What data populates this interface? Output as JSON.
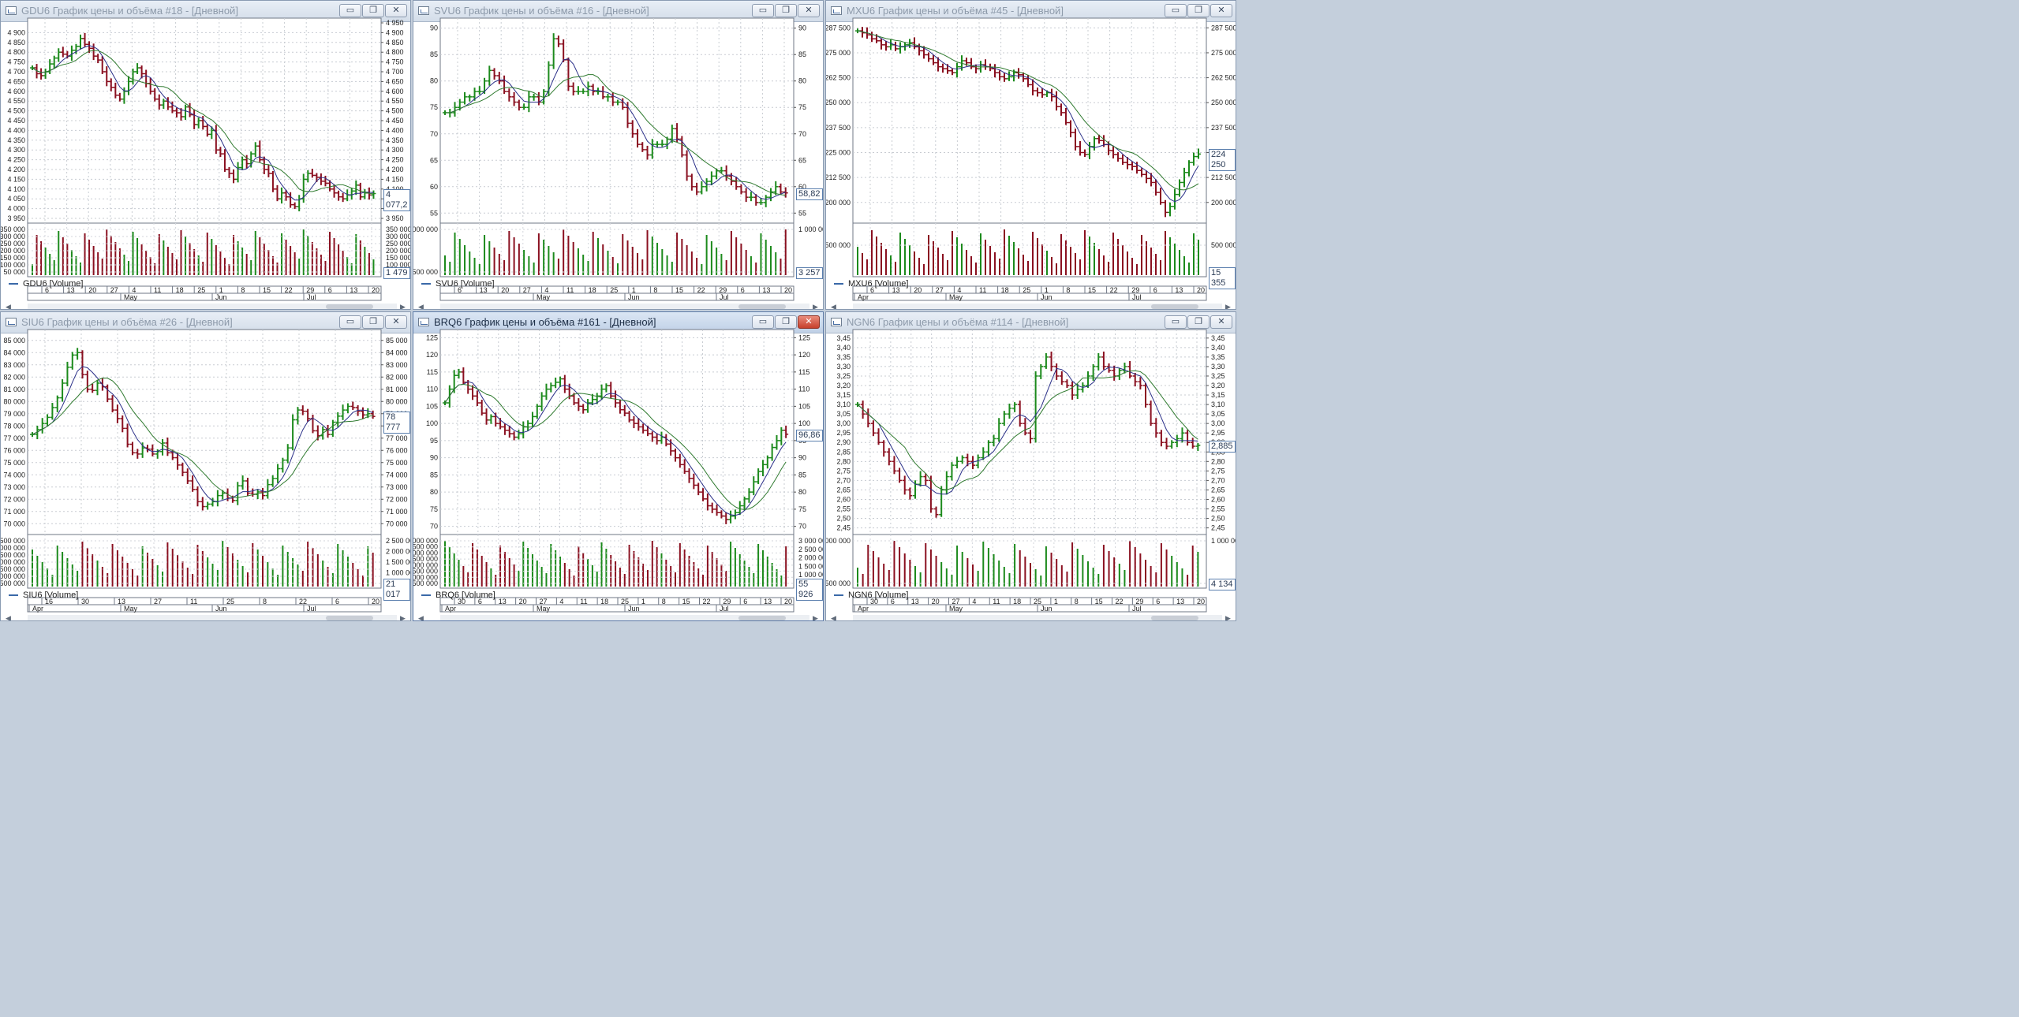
{
  "windows": [
    {
      "id": "gdu6",
      "title": "GDU6 График цены и объёма #18 - [Дневной]",
      "volume_label": "GDU6 [Volume]",
      "price_last": "4 077,2",
      "volume_last": "1 479",
      "price_ticks": [
        "4 900",
        "4 850",
        "4 800",
        "4 750",
        "4 700",
        "4 650",
        "4 600",
        "4 550",
        "4 500",
        "4 450",
        "4 400",
        "4 350",
        "4 300",
        "4 250",
        "4 200",
        "4 150",
        "4 100",
        "4 050",
        "4 000",
        "3 950"
      ],
      "price_ticks_right": [
        "4 950",
        "4 900",
        "4 850",
        "4 800",
        "4 750",
        "4 700",
        "4 650",
        "4 600",
        "4 550",
        "4 500",
        "4 450",
        "4 400",
        "4 350",
        "4 300",
        "4 250",
        "4 200",
        "4 150",
        "4 100",
        "4 050",
        "4 000",
        "3 950"
      ],
      "volume_ticks": [
        "350 000",
        "300 000",
        "250 000",
        "200 000",
        "150 000",
        "100 000",
        "50 000"
      ],
      "volume_ticks_right": [
        "350 000",
        "300 000",
        "250 000",
        "200 000",
        "150 000",
        "100 000",
        "50 000"
      ],
      "date_days": [
        "6",
        "13",
        "20",
        "27",
        "4",
        "11",
        "18",
        "25",
        "1",
        "8",
        "15",
        "22",
        "29",
        "6",
        "13",
        "20"
      ],
      "date_months": [
        "May",
        "Jun",
        "Jul"
      ]
    },
    {
      "id": "svu6",
      "title": "SVU6 График цены и объёма #16 - [Дневной]",
      "volume_label": "SVU6 [Volume]",
      "price_last": "58,82",
      "volume_last": "3 257",
      "price_ticks": [
        "90",
        "85",
        "80",
        "75",
        "70",
        "65",
        "60",
        "55"
      ],
      "price_ticks_right": [
        "90",
        "85",
        "80",
        "75",
        "70",
        "65",
        "60",
        "55"
      ],
      "volume_ticks": [
        "000 000",
        "500 000"
      ],
      "volume_ticks_right": [
        "1 000 000",
        "500 000"
      ],
      "date_days": [
        "6",
        "13",
        "20",
        "27",
        "4",
        "11",
        "18",
        "25",
        "1",
        "8",
        "15",
        "22",
        "29",
        "6",
        "13",
        "20"
      ],
      "date_months": [
        "May",
        "Jun",
        "Jul"
      ]
    },
    {
      "id": "mxu6",
      "title": "MXU6 График цены и объёма #45 - [Дневной]",
      "volume_label": "MXU6 [Volume]",
      "price_last": "224 250",
      "volume_last": "15 355",
      "price_ticks": [
        "287 500",
        "275 000",
        "262 500",
        "250 000",
        "237 500",
        "225 000",
        "212 500",
        "200 000"
      ],
      "price_ticks_right": [
        "287 500",
        "275 000",
        "262 500",
        "250 000",
        "237 500",
        "225 000",
        "212 500",
        "200 000"
      ],
      "volume_ticks": [
        "500 000"
      ],
      "volume_ticks_right": [
        "500 000"
      ],
      "date_days": [
        "6",
        "13",
        "20",
        "27",
        "4",
        "11",
        "18",
        "25",
        "1",
        "8",
        "15",
        "22",
        "29",
        "6",
        "13",
        "20"
      ],
      "date_months": [
        "Apr",
        "May",
        "Jun",
        "Jul"
      ]
    },
    {
      "id": "siu6",
      "title": "SIU6 График цены и объёма #26 - [Дневной]",
      "volume_label": "SIU6 [Volume]",
      "price_last": "78 777",
      "volume_last": "21 017",
      "price_ticks": [
        "85 000",
        "84 000",
        "83 000",
        "82 000",
        "81 000",
        "80 000",
        "79 000",
        "78 000",
        "77 000",
        "76 000",
        "75 000",
        "74 000",
        "73 000",
        "72 000",
        "71 000",
        "70 000"
      ],
      "price_ticks_right": [
        "85 000",
        "84 000",
        "83 000",
        "82 000",
        "81 000",
        "80 000",
        "79 000",
        "78 000",
        "77 000",
        "76 000",
        "75 000",
        "74 000",
        "73 000",
        "72 000",
        "71 000",
        "70 000"
      ],
      "volume_ticks": [
        "500 000",
        "000 000",
        "500 000",
        "000 000",
        "500 000",
        "000 000",
        "500 000"
      ],
      "volume_ticks_right": [
        "2 500 000",
        "2 000 000",
        "1 500 000",
        "1 000 000",
        "500 000"
      ],
      "date_days": [
        "16",
        "30",
        "13",
        "27",
        "11",
        "25",
        "8",
        "22",
        "6",
        "20"
      ],
      "date_months": [
        "Apr",
        "May",
        "Jun",
        "Jul"
      ]
    },
    {
      "id": "brq6",
      "title": "BRQ6 График цены и объёма #161 - [Дневной]",
      "volume_label": "BRQ6 [Volume]",
      "price_last": "96,86",
      "volume_last": "55 926",
      "price_ticks": [
        "125",
        "120",
        "115",
        "110",
        "105",
        "100",
        "95",
        "90",
        "85",
        "80",
        "75",
        "70"
      ],
      "price_ticks_right": [
        "125",
        "120",
        "115",
        "110",
        "105",
        "100",
        "95",
        "90",
        "85",
        "80",
        "75",
        "70"
      ],
      "volume_ticks": [
        "000 000",
        "500 000",
        "000 000",
        "500 000",
        "000 000",
        "500 000",
        "000 000",
        "500 000"
      ],
      "volume_ticks_right": [
        "3 000 000",
        "2 500 000",
        "2 000 000",
        "1 500 000",
        "1 000 000",
        "500 000"
      ],
      "date_days": [
        "30",
        "6",
        "13",
        "20",
        "27",
        "4",
        "11",
        "18",
        "25",
        "1",
        "8",
        "15",
        "22",
        "29",
        "6",
        "13",
        "20"
      ],
      "date_months": [
        "Apr",
        "May",
        "Jun",
        "Jul"
      ]
    },
    {
      "id": "ngn6",
      "title": "NGN6 График цены и объёма #114 - [Дневной]",
      "volume_label": "NGN6 [Volume]",
      "price_last": "2,885",
      "volume_last": "4 134",
      "price_ticks": [
        "3,45",
        "3,40",
        "3,35",
        "3,30",
        "3,25",
        "3,20",
        "3,15",
        "3,10",
        "3,05",
        "3,00",
        "2,95",
        "2,90",
        "2,85",
        "2,80",
        "2,75",
        "2,70",
        "2,65",
        "2,60",
        "2,55",
        "2,50",
        "2,45"
      ],
      "price_ticks_right": [
        "3,45",
        "3,40",
        "3,35",
        "3,30",
        "3,25",
        "3,20",
        "3,15",
        "3,10",
        "3,05",
        "3,00",
        "2,95",
        "2,90",
        "2,85",
        "2,80",
        "2,75",
        "2,70",
        "2,65",
        "2,60",
        "2,55",
        "2,50",
        "2,45"
      ],
      "volume_ticks": [
        "000 000",
        "500 000"
      ],
      "volume_ticks_right": [
        "1 000 000",
        "500 000"
      ],
      "date_days": [
        "30",
        "6",
        "13",
        "20",
        "27",
        "4",
        "11",
        "18",
        "25",
        "1",
        "8",
        "15",
        "22",
        "29",
        "6",
        "13",
        "20"
      ],
      "date_months": [
        "Apr",
        "May",
        "Jun",
        "Jul"
      ]
    }
  ],
  "window_buttons": {
    "minimize": "▭",
    "restore": "❐",
    "close": "✕"
  },
  "chart_data": [
    {
      "type": "ohlc",
      "window": "gdu6",
      "ylim": [
        3950,
        4950
      ],
      "closes": [
        4720,
        4690,
        4680,
        4700,
        4740,
        4770,
        4800,
        4790,
        4780,
        4810,
        4830,
        4870,
        4840,
        4820,
        4780,
        4760,
        4700,
        4650,
        4620,
        4580,
        4560,
        4600,
        4650,
        4700,
        4720,
        4690,
        4640,
        4600,
        4560,
        4530,
        4550,
        4520,
        4500,
        4490,
        4470,
        4520,
        4480,
        4430,
        4450,
        4420,
        4380,
        4400,
        4300,
        4280,
        4200,
        4180,
        4150,
        4210,
        4250,
        4230,
        4280,
        4320,
        4250,
        4200,
        4180,
        4100,
        4050,
        4080,
        4060,
        4020,
        4010,
        4050,
        4150,
        4180,
        4170,
        4160,
        4140,
        4130,
        4100,
        4080,
        4060,
        4050,
        4070,
        4090,
        4120,
        4060,
        4080,
        4070,
        4077
      ]
    },
    {
      "type": "ohlc",
      "window": "svu6",
      "ylim": [
        54,
        91
      ],
      "closes": [
        74,
        74,
        75,
        76,
        77,
        77,
        78,
        78,
        80,
        82,
        81,
        80,
        78,
        77,
        76,
        75,
        75,
        77,
        77,
        76,
        78,
        83,
        88,
        87,
        84,
        79,
        78,
        78,
        78,
        79,
        78,
        78,
        77,
        77,
        76,
        76,
        75,
        72,
        70,
        68,
        67,
        66,
        68,
        68,
        68,
        69,
        71,
        69,
        66,
        62,
        60,
        59,
        60,
        61,
        62,
        63,
        63,
        62,
        61,
        60,
        59,
        58,
        58,
        57,
        57,
        58,
        59,
        60,
        59,
        58.82
      ]
    },
    {
      "type": "ohlc",
      "window": "mxu6",
      "ylim": [
        192000,
        290000
      ],
      "closes": [
        286000,
        285000,
        284000,
        282000,
        281000,
        279000,
        278000,
        279000,
        277000,
        278000,
        279000,
        280000,
        278000,
        276000,
        274000,
        272000,
        270000,
        268000,
        267000,
        266000,
        265000,
        268000,
        271000,
        270000,
        268000,
        267000,
        269000,
        268000,
        267000,
        265000,
        263000,
        262000,
        263000,
        265000,
        264000,
        262000,
        259000,
        256000,
        255000,
        254000,
        255000,
        253000,
        248000,
        245000,
        240000,
        235000,
        228000,
        225000,
        224000,
        228000,
        232000,
        231000,
        229000,
        226000,
        224000,
        222000,
        220000,
        219000,
        218000,
        216000,
        214000,
        212000,
        210000,
        205000,
        200000,
        195000,
        198000,
        204000,
        210000,
        215000,
        220000,
        223000,
        224250
      ]
    },
    {
      "type": "ohlc",
      "window": "siu6",
      "ylim": [
        69500,
        85500
      ],
      "closes": [
        77300,
        77700,
        78200,
        78700,
        79500,
        80300,
        81500,
        82800,
        83800,
        84000,
        82200,
        81000,
        80900,
        81500,
        81200,
        80200,
        79300,
        78600,
        77800,
        76500,
        75800,
        75700,
        76200,
        76100,
        75700,
        75900,
        76600,
        75800,
        75400,
        74800,
        74200,
        73500,
        72800,
        71800,
        71400,
        71600,
        71800,
        72300,
        72500,
        72100,
        71900,
        73100,
        73500,
        72500,
        72400,
        72600,
        72300,
        73200,
        73700,
        74500,
        75200,
        76200,
        78500,
        79300,
        79200,
        78600,
        77600,
        77200,
        77700,
        77300,
        78300,
        78800,
        79300,
        79600,
        79500,
        79200,
        78900,
        79000,
        78777
      ]
    },
    {
      "type": "ohlc",
      "window": "brq6",
      "ylim": [
        69,
        126
      ],
      "closes": [
        106,
        110,
        114,
        115,
        112,
        110,
        108,
        106,
        103,
        101,
        102,
        100,
        99,
        98,
        97,
        96,
        97,
        99,
        100,
        102,
        105,
        108,
        110,
        111,
        112,
        113,
        110,
        108,
        106,
        105,
        104,
        106,
        107,
        108,
        110,
        111,
        108,
        106,
        104,
        103,
        101,
        100,
        99,
        98,
        97,
        96,
        95,
        96,
        94,
        92,
        90,
        88,
        86,
        84,
        82,
        80,
        78,
        76,
        75,
        74,
        73,
        72,
        73,
        74,
        76,
        78,
        80,
        83,
        86,
        88,
        90,
        93,
        95,
        98,
        96.86
      ]
    },
    {
      "type": "ohlc",
      "window": "ngn6",
      "ylim": [
        2.44,
        3.47
      ],
      "closes": [
        3.1,
        3.05,
        3.0,
        2.95,
        2.9,
        2.85,
        2.8,
        2.75,
        2.7,
        2.65,
        2.62,
        2.68,
        2.72,
        2.7,
        2.55,
        2.52,
        2.65,
        2.72,
        2.78,
        2.8,
        2.82,
        2.8,
        2.78,
        2.82,
        2.85,
        2.9,
        2.92,
        3.0,
        3.05,
        3.08,
        3.1,
        3.0,
        2.95,
        2.92,
        3.25,
        3.3,
        3.35,
        3.3,
        3.25,
        3.22,
        3.2,
        3.15,
        3.18,
        3.2,
        3.25,
        3.3,
        3.35,
        3.3,
        3.28,
        3.25,
        3.28,
        3.3,
        3.25,
        3.22,
        3.2,
        3.1,
        3.0,
        2.95,
        2.9,
        2.88,
        2.9,
        2.92,
        2.95,
        2.9,
        2.88,
        2.885
      ]
    }
  ]
}
